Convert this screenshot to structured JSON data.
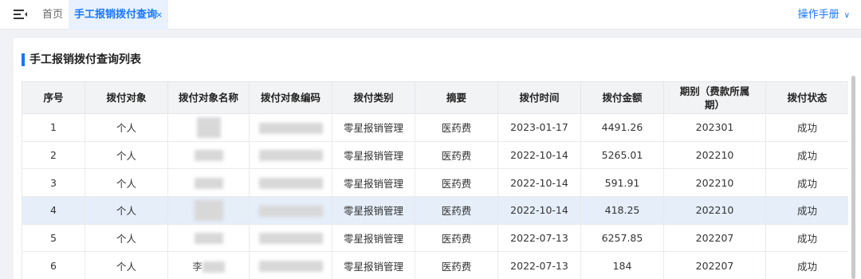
{
  "header": {
    "home_tab": "首页",
    "active_tab": "手工报销拨付查询",
    "close_glyph": "×",
    "manual_label": "操作手册",
    "manual_chevron": "∨"
  },
  "section": {
    "title": "手工报销拨付查询列表"
  },
  "table": {
    "columns": [
      "序号",
      "拨付对象",
      "拨付对象名称",
      "拨付对象编码",
      "拨付类别",
      "摘要",
      "拨付时间",
      "拨付金额",
      "期别（费款所属期）",
      "拨付状态"
    ],
    "rows": [
      {
        "seq": "1",
        "target": "个人",
        "name": "",
        "code": "",
        "category": "零星报销管理",
        "summary": "医药费",
        "date": "2023-01-17",
        "amount": "4491.26",
        "period": "202301",
        "status": "成功"
      },
      {
        "seq": "2",
        "target": "个人",
        "name": "",
        "code": "",
        "category": "零星报销管理",
        "summary": "医药费",
        "date": "2022-10-14",
        "amount": "5265.01",
        "period": "202210",
        "status": "成功"
      },
      {
        "seq": "3",
        "target": "个人",
        "name": "",
        "code": "",
        "category": "零星报销管理",
        "summary": "医药费",
        "date": "2022-10-14",
        "amount": "591.91",
        "period": "202210",
        "status": "成功"
      },
      {
        "seq": "4",
        "target": "个人",
        "name": "",
        "code": "",
        "category": "零星报销管理",
        "summary": "医药费",
        "date": "2022-10-14",
        "amount": "418.25",
        "period": "202210",
        "status": "成功"
      },
      {
        "seq": "5",
        "target": "个人",
        "name": "",
        "code": "",
        "category": "零星报销管理",
        "summary": "医药费",
        "date": "2022-07-13",
        "amount": "6257.85",
        "period": "202207",
        "status": "成功"
      },
      {
        "seq": "6",
        "target": "个人",
        "name": "李",
        "code": "",
        "category": "零星报销管理",
        "summary": "医药费",
        "date": "2022-07-13",
        "amount": "184",
        "period": "202207",
        "status": "成功"
      }
    ]
  },
  "colors": {
    "accent": "#1677ff",
    "selected_row": "#e5eef9",
    "header_bg": "#f2f3f5"
  },
  "icons": {
    "menu": "menu-fold-icon",
    "close": "close-icon",
    "chevron": "chevron-down-icon"
  }
}
